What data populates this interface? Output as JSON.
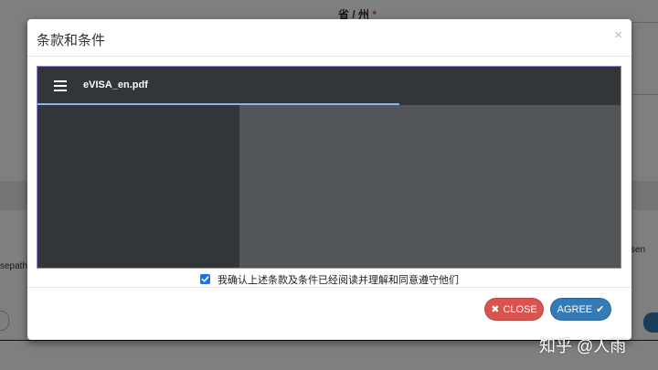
{
  "background": {
    "province_label": "省 / 州",
    "required_mark": "*",
    "left_text": "sepath",
    "right_text": "sen"
  },
  "modal": {
    "title": "条款和条件",
    "close_x": "×",
    "pdf_viewer": {
      "menu_icon": "hamburger-menu-icon",
      "filename": "eVISA_en.pdf",
      "load_progress": 0.62
    },
    "agree_checkbox": {
      "checked": true,
      "label": "我确认上述条款及条件已经阅读并理解和同意遵守他们"
    },
    "buttons": {
      "close_label": "CLOSE",
      "close_icon": "times-icon",
      "agree_label": "AGREE",
      "agree_icon": "check-icon"
    }
  },
  "watermark": "知乎 @人雨",
  "colors": {
    "close_button": "#d9534f",
    "agree_button": "#337ab7",
    "pdf_toolbar": "#323639",
    "pdf_content": "#525659",
    "progress": "#8ab4f8",
    "checkbox": "#1a73e8"
  }
}
